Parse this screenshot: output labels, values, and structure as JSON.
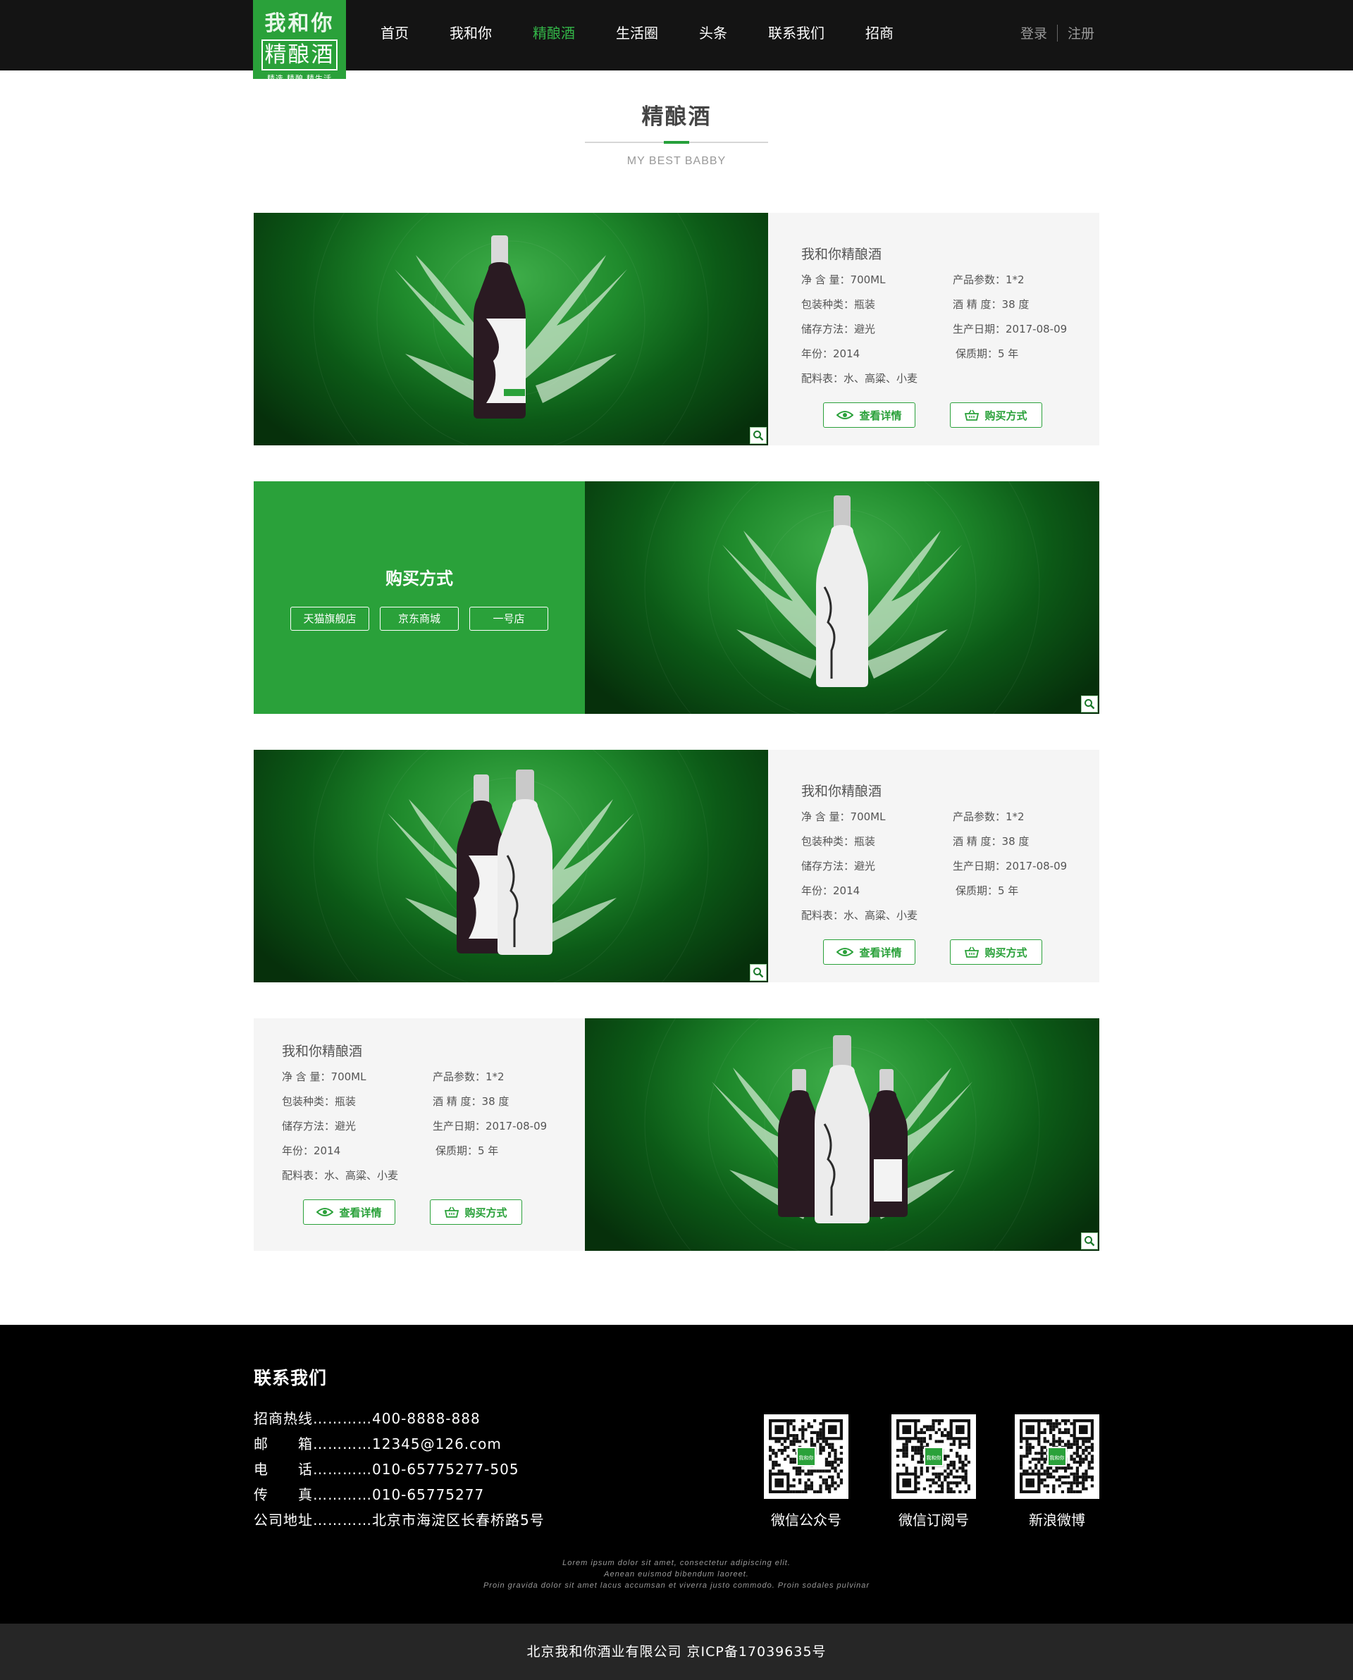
{
  "brand": {
    "line1": "我和你",
    "line2": "精酿酒",
    "tagline": "精选.精酿.精生活"
  },
  "nav": [
    {
      "label": "首页"
    },
    {
      "label": "我和你"
    },
    {
      "label": "精酿酒"
    },
    {
      "label": "生活圈"
    },
    {
      "label": "头条"
    },
    {
      "label": "联系我们"
    },
    {
      "label": "招商"
    }
  ],
  "nav_active": "精酿酒",
  "account": {
    "login": "登录",
    "register": "注册"
  },
  "section": {
    "title": "精酿酒",
    "subtitle": "MY BEST BABBY"
  },
  "product": {
    "name": "我和你精酿酒",
    "specs": {
      "volume": "净 含 量：700ML",
      "params": "产品参数：1*2",
      "package": "包装种类：瓶装",
      "abv": "酒 精 度：38 度",
      "storage": "储存方法：避光",
      "date": "生产日期：2017-08-09",
      "year": "年份：2014",
      "shelf": "保质期：5 年",
      "ingredients": "配料表：水、高粱、小麦"
    },
    "detail_btn": "查看详情",
    "buy_btn": "购买方式"
  },
  "buy": {
    "title": "购买方式",
    "stores": [
      "天猫旗舰店",
      "京东商城",
      "一号店"
    ]
  },
  "footer": {
    "title": "联系我们",
    "contacts": [
      "招商热线…………400-8888-888",
      "邮　　箱…………12345@126.com",
      "电　　话…………010-65775277-505",
      "传　　真…………010-65775277",
      "公司地址…………北京市海淀区长春桥路5号"
    ],
    "qrcodes": [
      "微信公众号",
      "微信订阅号",
      "新浪微博"
    ],
    "qr_badge": "我和你",
    "lorem": [
      "Lorem ipsum dolor sit amet, consectetur adipiscing elit.",
      "Aenean euismod bibendum laoreet.",
      "Proin gravida dolor sit amet lacus accumsan et viverra justo commodo. Proin sodales pulvinar"
    ],
    "copyright": "北京我和你酒业有限公司 京ICP备17039635号"
  },
  "colors": {
    "accent": "#2aa13a",
    "nav_bg": "#141414",
    "footer_bg": "#000000",
    "panel_bg": "#f5f5f5"
  }
}
